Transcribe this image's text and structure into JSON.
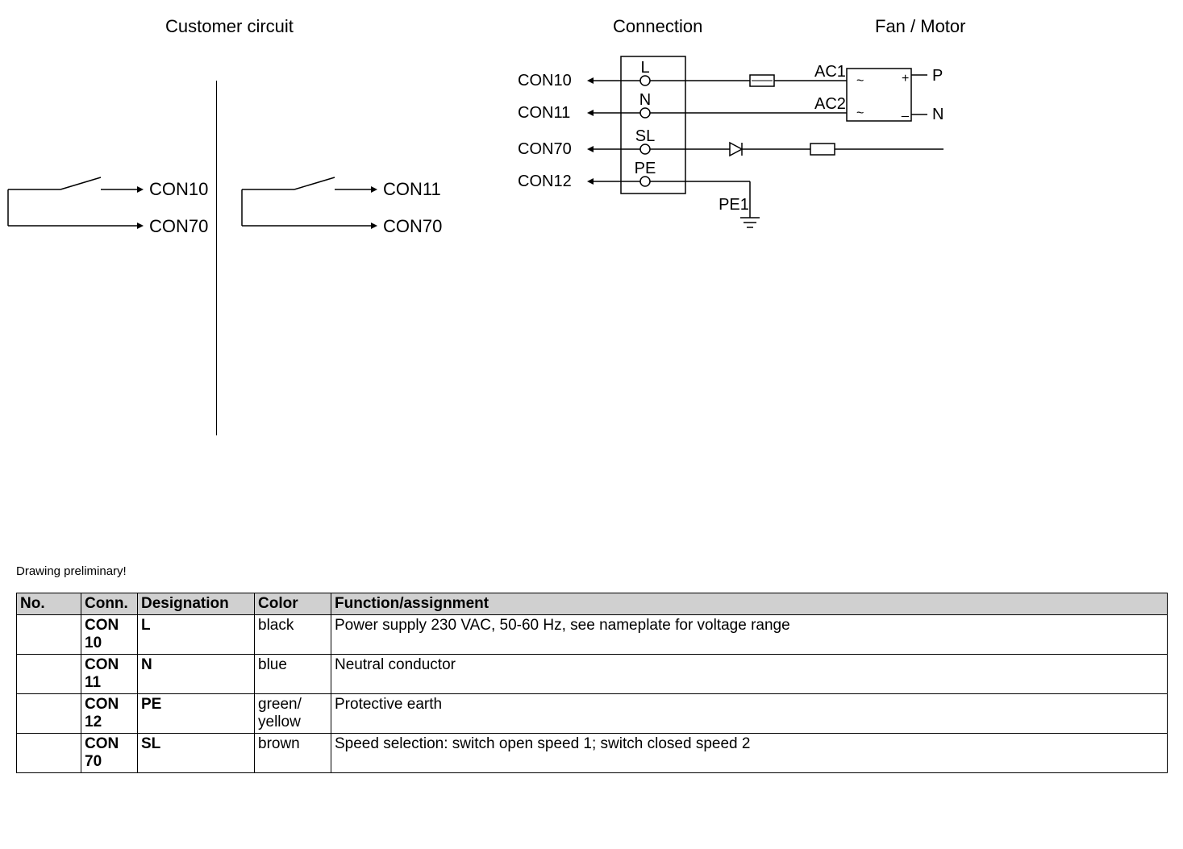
{
  "headers": {
    "customer_circuit": "Customer circuit",
    "connection": "Connection",
    "fan_motor": "Fan / Motor"
  },
  "labels": {
    "con10": "CON10",
    "con11": "CON11",
    "con12": "CON12",
    "con70": "CON70",
    "l": "L",
    "n": "N",
    "sl": "SL",
    "pe": "PE",
    "pe1": "PE1",
    "ac1": "AC1",
    "ac2": "AC2",
    "p": "P",
    "nn": "N",
    "tilde": "~",
    "plus": "+",
    "minus": "_"
  },
  "status": {
    "preliminary": "Drawing preliminary!"
  },
  "table": {
    "headers": {
      "no": "No.",
      "conn": "Conn.",
      "designation": "Designation",
      "color": "Color",
      "function": "Function/assignment"
    },
    "rows": [
      {
        "no": "",
        "conn": "CON 10",
        "designation": "L",
        "color": "black",
        "function": "Power supply 230 VAC, 50-60 Hz, see nameplate for voltage range"
      },
      {
        "no": "",
        "conn": "CON 11",
        "designation": "N",
        "color": "blue",
        "function": "Neutral conductor"
      },
      {
        "no": "",
        "conn": "CON 12",
        "designation": "PE",
        "color": "green/\nyellow",
        "function": "Protective earth"
      },
      {
        "no": "",
        "conn": "CON 70",
        "designation": "SL",
        "color": "brown",
        "function": "Speed selection: switch open speed 1; switch closed speed 2"
      }
    ]
  }
}
